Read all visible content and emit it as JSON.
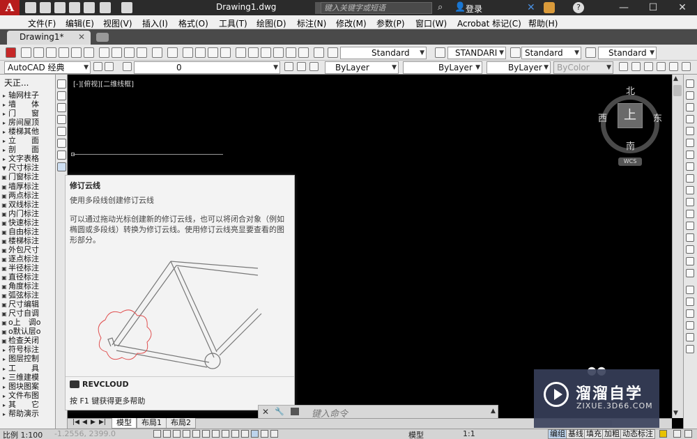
{
  "app": {
    "logo_letter": "A",
    "title": "Drawing1.dwg"
  },
  "titlebar": {
    "search_placeholder": "键入关键字或短语",
    "login": "登录",
    "minimize": "—",
    "maximize": "☐",
    "close": "✕",
    "help": "?"
  },
  "menu": [
    "文件(F)",
    "编辑(E)",
    "视图(V)",
    "插入(I)",
    "格式(O)",
    "工具(T)",
    "绘图(D)",
    "标注(N)",
    "修改(M)",
    "参数(P)",
    "窗口(W)",
    "Acrobat 标记(C)",
    "帮助(H)"
  ],
  "doc_tab": {
    "label": "Drawing1*",
    "close": "✕"
  },
  "toolbar1": {
    "text_style": "Standard",
    "dim_style": "STANDARI",
    "table_style": "Standard",
    "multileader_style": "Standard"
  },
  "toolbar2": {
    "workspace": "AutoCAD 经典",
    "layer": "0",
    "color": "ByLayer",
    "linetype": "ByLayer",
    "lineweight": "ByLayer",
    "plotstyle": "ByColor"
  },
  "left_panel": {
    "title": "天正...",
    "items": [
      "轴网柱子",
      "墙　　体",
      "门　　窗",
      "房间屋顶",
      "楼梯其他",
      "立　　面",
      "剖　　面",
      "文字表格",
      "尺寸标注",
      "门窗标注",
      "墙厚标注",
      "两点标注",
      "双线标注",
      "内门标注",
      "快速标注",
      "自由标注",
      "楼梯标注",
      "外包尺寸",
      "逐点标注",
      "半径标注",
      "直径标注",
      "角度标注",
      "弧弦标注",
      "尺寸编辑",
      "尺寸自调",
      "o上　调o",
      "o默认层o",
      "检查关闭",
      "符号标注",
      "图层控制",
      "工　　具",
      "三维建模",
      "图块图案",
      "文件布图",
      "其　　它",
      "帮助演示"
    ]
  },
  "canvas": {
    "view_label": "[-][俯视][二维线框]"
  },
  "viewcube": {
    "face": "上",
    "north": "北",
    "south": "南",
    "east": "东",
    "west": "西",
    "wcs": "WCS"
  },
  "tooltip": {
    "title": "修订云线",
    "subtitle": "使用多段线创建修订云线",
    "description": "可以通过拖动光标创建新的修订云线，也可以将闭合对象（例如椭圆或多段线）转换为修订云线。使用修订云线亮显要查看的图形部分。",
    "command": "REVCLOUD",
    "help": "按 F1 键获得更多帮助"
  },
  "cmdline": {
    "placeholder": "键入命令"
  },
  "layout_tabs": [
    "模型",
    "布局1",
    "布局2"
  ],
  "status": {
    "scale": "比例 1:100",
    "coords": "-1.2556, 2399.0",
    "model": "模型",
    "zoom": "1:1",
    "buttons": [
      "编组",
      "基线",
      "填充",
      "加粗",
      "动态标注"
    ]
  },
  "watermark": {
    "title": "溜溜自学",
    "url": "ZIXUE.3D66.COM"
  },
  "colors": {
    "titlebar": "#2b2b2b",
    "canvas": "#000000",
    "tooltip_bg": "#f3f3f3",
    "cloud": "#e05050"
  }
}
